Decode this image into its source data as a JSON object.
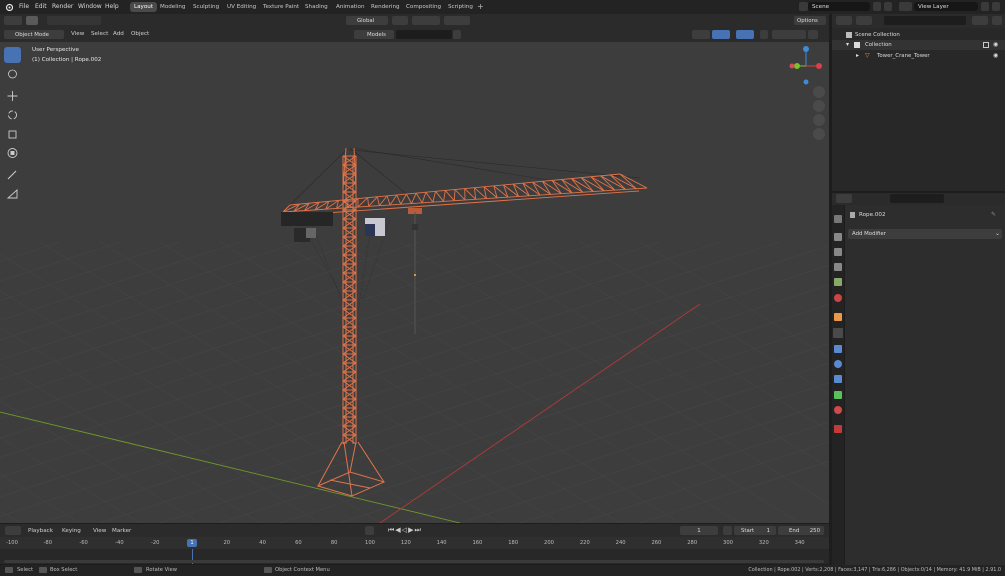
{
  "menubar": {
    "items": [
      "File",
      "Edit",
      "Render",
      "Window",
      "Help"
    ],
    "workspaces": [
      "Layout",
      "Modeling",
      "Sculpting",
      "UV Editing",
      "Texture Paint",
      "Shading",
      "Animation",
      "Rendering",
      "Compositing",
      "Scripting"
    ],
    "active_workspace": "Layout",
    "scene": "Scene",
    "view_layer": "View Layer"
  },
  "viewport_header": {
    "mode": "Object Mode",
    "menus": [
      "View",
      "Select",
      "Add",
      "Object"
    ],
    "orientation": "Global",
    "collection_filter": "Models",
    "options": "Options"
  },
  "viewport": {
    "overlay_title": "User Perspective",
    "overlay_subtitle": "(1) Collection | Rope.002",
    "background_color": "#3d3d3d",
    "grid_color": "#474747",
    "x_axis_color": "#b03a3a",
    "y_axis_color": "#6f9a2a",
    "crane_color": "#e0744a",
    "gizmo": {
      "x_color": "#d9404a",
      "y_color": "#7fbf2a",
      "z_color": "#3d8bd9"
    }
  },
  "outliner": {
    "scene_collection": "Scene Collection",
    "collection": "Collection",
    "object": "Tower_Crane_Tower"
  },
  "properties": {
    "object_name": "Rope.002",
    "add_modifier": "Add Modifier"
  },
  "timeline": {
    "menus": [
      "Playback",
      "Keying",
      "View",
      "Marker"
    ],
    "current_frame": "1",
    "start_label": "Start",
    "start": "1",
    "end_label": "End",
    "end": "250",
    "ticks": [
      "-100",
      "-80",
      "-60",
      "-40",
      "-20",
      "1",
      "20",
      "40",
      "60",
      "80",
      "100",
      "120",
      "140",
      "160",
      "180",
      "200",
      "220",
      "240",
      "260",
      "280",
      "300",
      "320",
      "340"
    ]
  },
  "statusbar": {
    "select": "Select",
    "box_select": "Box Select",
    "rotate_view": "Rotate View",
    "context_menu": "Object Context Menu",
    "stats": "Collection | Rope.002 | Verts:2,208 | Faces:3,147 | Tris:6,286 | Objects:0/14 | Memory: 41.9 MiB | 2.91.0"
  }
}
